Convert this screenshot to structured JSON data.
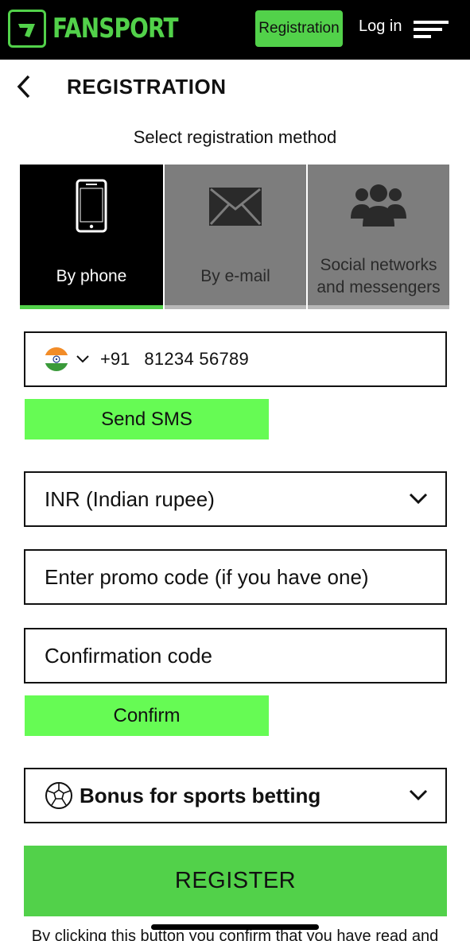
{
  "header": {
    "logo_text": "FANSPORT",
    "registration_label": "Registration",
    "login_label": "Log in",
    "accent_color": "#52d14a",
    "menu_icon": "hamburger-menu-icon",
    "logo_icon": "fansport-logo-icon"
  },
  "page": {
    "title": "REGISTRATION",
    "back_icon": "chevron-left-icon",
    "method_caption": "Select registration method"
  },
  "methods": [
    {
      "label": "By phone",
      "icon": "smartphone-icon",
      "active": true
    },
    {
      "label": "By e-mail",
      "icon": "envelope-icon",
      "active": false
    },
    {
      "label_line1": "Social networks",
      "label_line2": "and messengers",
      "icon": "users-group-icon",
      "active": false
    }
  ],
  "form": {
    "phone": {
      "country_flag": "india-flag-icon",
      "dial_code": "+91",
      "number": "81234 56789"
    },
    "send_sms_label": "Send SMS",
    "currency_value": "INR (Indian rupee)",
    "promo_placeholder": "Enter promo code (if you have one)",
    "confirmation_placeholder": "Confirmation code",
    "confirm_label": "Confirm",
    "bonus_value": "Bonus for sports betting",
    "bonus_icon": "soccer-ball-icon",
    "register_label": "REGISTER",
    "terms_text": "By clicking this button you confirm that you have read and"
  },
  "colors": {
    "green_button": "#66fb54",
    "register_green": "#52d14a",
    "tab_inactive": "#7d7d7d"
  }
}
